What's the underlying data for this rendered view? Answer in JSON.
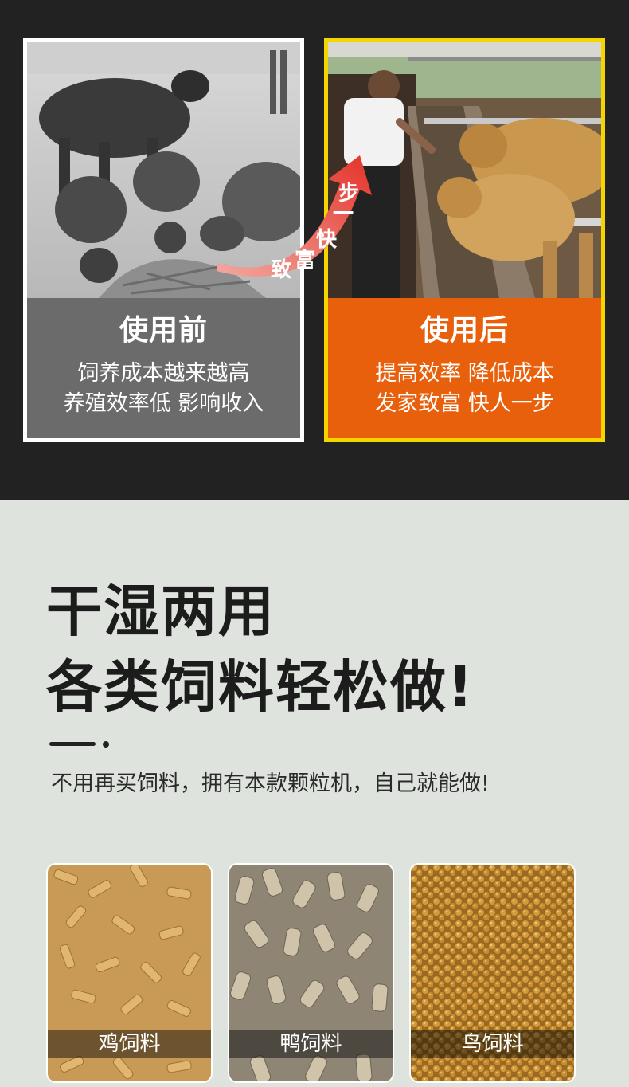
{
  "before": {
    "title": "使用前",
    "line1": "饲养成本越来越高",
    "line2": "养殖效率低  影响收入"
  },
  "after": {
    "title": "使用后",
    "line1": "提高效率  降低成本",
    "line2": "发家致富  快人一步"
  },
  "arrow_chars": [
    "致",
    "富",
    "快",
    "一",
    "步"
  ],
  "headline": {
    "line1": "干湿两用",
    "line2": "各类饲料轻松做!"
  },
  "subtitle": "不用再买饲料，拥有本款颗粒机，自己就能做!",
  "feeds": [
    {
      "label": "鸡饲料"
    },
    {
      "label": "鸭饲料"
    },
    {
      "label": "鸟饲料"
    }
  ],
  "colors": {
    "dark_bg": "#222222",
    "before_panel": "#6b6b6b",
    "after_panel": "#e8600b",
    "after_frame": "#f5d500",
    "section_bg": "#dfe3de"
  }
}
